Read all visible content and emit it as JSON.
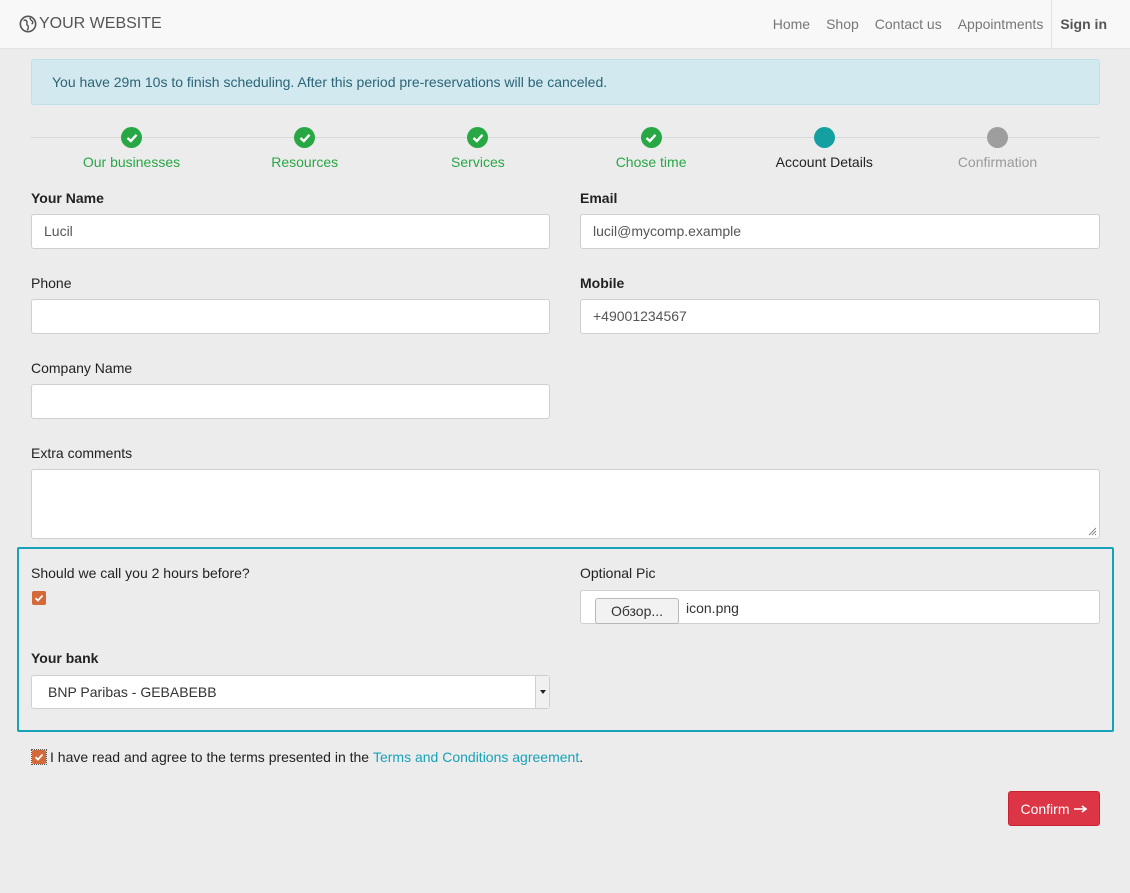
{
  "navbar": {
    "brand": "YOUR WEBSITE",
    "items": [
      "Home",
      "Shop",
      "Contact us",
      "Appointments"
    ],
    "signin": "Sign in"
  },
  "alert": {
    "text": "You have 29m 10s to finish scheduling. After this period pre-reservations will be canceled."
  },
  "steps": [
    {
      "label": "Our businesses",
      "state": "done"
    },
    {
      "label": "Resources",
      "state": "done"
    },
    {
      "label": "Services",
      "state": "done"
    },
    {
      "label": "Chose time",
      "state": "done"
    },
    {
      "label": "Account Details",
      "state": "active"
    },
    {
      "label": "Confirmation",
      "state": "pending"
    }
  ],
  "form": {
    "name_label": "Your Name",
    "name_value": "Lucil",
    "email_label": "Email",
    "email_value": "lucil@mycomp.example",
    "phone_label": "Phone",
    "phone_value": "",
    "mobile_label": "Mobile",
    "mobile_value": "+49001234567",
    "company_label": "Company Name",
    "company_value": "",
    "comments_label": "Extra comments",
    "comments_value": "",
    "call_label": "Should we call you 2 hours before?",
    "call_checked": true,
    "pic_label": "Optional Pic",
    "file_button": "Обзор...",
    "file_name": "icon.png",
    "bank_label": "Your bank",
    "bank_value": "BNP Paribas - GEBABEBB",
    "terms_prefix": "I have read and agree to the terms presented in the ",
    "terms_link": "Terms and Conditions agreement",
    "terms_suffix": ".",
    "terms_checked": true,
    "confirm_label": "Confirm"
  },
  "colors": {
    "done": "#28a745",
    "active": "#14a0a0",
    "pending": "#9e9e9e",
    "confirm": "#dc3545",
    "accent": "#17a2b8",
    "checkbox": "#d4693a"
  }
}
